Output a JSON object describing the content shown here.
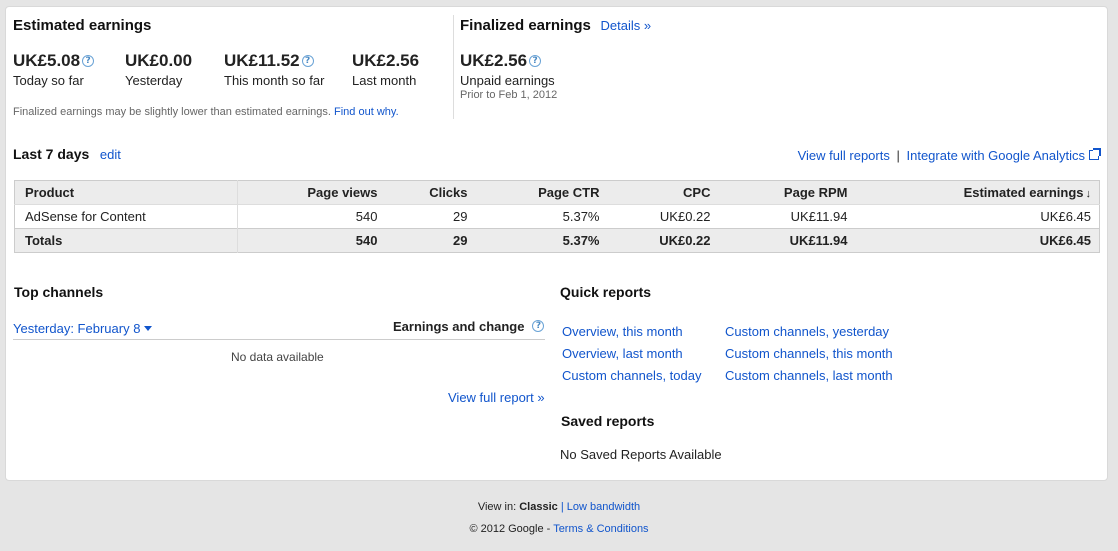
{
  "estimated": {
    "title": "Estimated earnings",
    "stats": [
      {
        "amount": "UK£5.08",
        "label": "Today so far",
        "help": true
      },
      {
        "amount": "UK£0.00",
        "label": "Yesterday",
        "help": false
      },
      {
        "amount": "UK£11.52",
        "label": "This month so far",
        "help": true
      },
      {
        "amount": "UK£2.56",
        "label": "Last month",
        "help": false
      }
    ],
    "note": "Finalized earnings may be slightly lower than estimated earnings.",
    "note_link": "Find out why."
  },
  "finalized": {
    "title": "Finalized earnings",
    "details_link": "Details »",
    "amount": "UK£2.56",
    "label": "Unpaid earnings",
    "sub": "Prior to Feb 1, 2012"
  },
  "help_glyph": "?",
  "last7": {
    "title": "Last 7 days",
    "edit_link": "edit",
    "view_full_reports": "View full reports",
    "separator": "|",
    "integrate_link": "Integrate with Google Analytics"
  },
  "table": {
    "headers": [
      "Product",
      "Page views",
      "Clicks",
      "Page CTR",
      "CPC",
      "Page RPM",
      "Estimated earnings"
    ],
    "sort_arrow": "↓",
    "rows": [
      [
        "AdSense for Content",
        "540",
        "29",
        "5.37%",
        "UK£0.22",
        "UK£11.94",
        "UK£6.45"
      ]
    ],
    "totals": [
      "Totals",
      "540",
      "29",
      "5.37%",
      "UK£0.22",
      "UK£11.94",
      "UK£6.45"
    ]
  },
  "top_channels": {
    "title": "Top channels",
    "date_selector": "Yesterday: February 8",
    "column_header": "Earnings and change",
    "empty": "No data available",
    "view_full_report": "View full report »"
  },
  "quick_reports": {
    "title": "Quick reports",
    "col1": [
      "Overview, this month",
      "Overview, last month",
      "Custom channels, today"
    ],
    "col2": [
      "Custom channels, yesterday",
      "Custom channels, this month",
      "Custom channels, last month"
    ]
  },
  "saved_reports": {
    "title": "Saved reports",
    "empty": "No Saved Reports Available"
  },
  "footer": {
    "view_in": "View in:",
    "classic": "Classic",
    "separator": "|",
    "low_bandwidth": "Low bandwidth",
    "copyright": "© 2012 Google -",
    "terms": "Terms & Conditions"
  }
}
